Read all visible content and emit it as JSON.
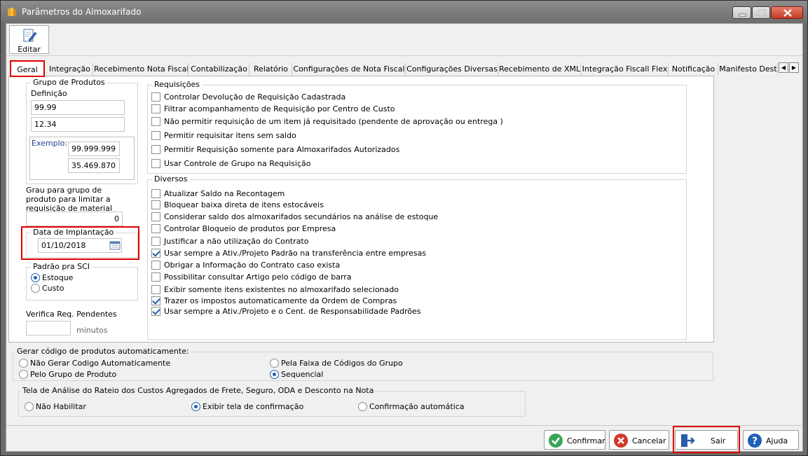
{
  "window": {
    "title": "Parâmetros do Almoxarifado"
  },
  "toolbar": {
    "edit_label": "Editar"
  },
  "tabs": [
    {
      "label": "Geral",
      "active": true
    },
    {
      "label": "Integração"
    },
    {
      "label": "Recebimento Nota Fiscal"
    },
    {
      "label": "Contabilização"
    },
    {
      "label": "Relatório"
    },
    {
      "label": "Configurações de Nota Fiscal"
    },
    {
      "label": "Configurações Diversas"
    },
    {
      "label": "Recebimento de XML"
    },
    {
      "label": "Integração Fiscall Flex"
    },
    {
      "label": "Notificação"
    },
    {
      "label": "Manifesto Dest"
    }
  ],
  "grupo_produtos": {
    "title": "Grupo de Produtos",
    "definicao_label": "Definição",
    "definicao_1": "99.99",
    "definicao_2": "12.34",
    "exemplo_label": "Exemplo:",
    "exemplo_1": "99.999.999",
    "exemplo_2": "35.469.870"
  },
  "grau": {
    "label": "Grau para grupo de produto para limitar a requisição de material",
    "value": "0"
  },
  "data_implantacao": {
    "title": "Data de Implantação",
    "value": "01/10/2018"
  },
  "padrao_sci": {
    "title": "Padrão pra SCI",
    "options": [
      {
        "label": "Estoque",
        "checked": true
      },
      {
        "label": "Custo",
        "checked": false
      }
    ]
  },
  "verifica": {
    "label": "Verifica Req. Pendentes",
    "value": "",
    "unit": "minutos"
  },
  "requisicoes": {
    "title": "Requisições",
    "items": [
      {
        "label": "Controlar Devolução de Requisição Cadastrada",
        "checked": false
      },
      {
        "label": "Filtrar acompanhamento de Requisição por Centro de Custo",
        "checked": false
      },
      {
        "label": "Não permitir requisição de um item já requisitado (pendente de aprovação ou entrega )",
        "checked": false
      },
      {
        "label": "Permitir requisitar itens sem saldo",
        "checked": false
      },
      {
        "label": "Permitir Requisição somente para Almoxarifados Autorizados",
        "checked": false
      },
      {
        "label": "Usar Controle de Grupo na Requisição",
        "checked": false
      }
    ]
  },
  "diversos": {
    "title": "Diversos",
    "items": [
      {
        "label": "Atualizar Saldo na Recontagem",
        "checked": false
      },
      {
        "label": "Bloquear baixa direta de itens estocáveis",
        "checked": false
      },
      {
        "label": "Considerar saldo dos almoxarifados secundários na análise de estoque",
        "checked": false
      },
      {
        "label": "Controlar Bloqueio de produtos por Empresa",
        "checked": false
      },
      {
        "label": "Justificar a não utilização do Contrato",
        "checked": false
      },
      {
        "label": "Usar sempre a Ativ./Projeto Padrão na transferência entre empresas",
        "checked": true
      },
      {
        "label": "Obrigar a Informação do Contrato caso exista",
        "checked": false
      },
      {
        "label": "Possibilitar consultar Artigo pelo código de barra",
        "checked": false
      },
      {
        "label": "Exibir somente itens existentes no almoxarifado selecionado",
        "checked": false
      },
      {
        "label": "Trazer os impostos automaticamente da Ordem de Compras",
        "checked": true
      },
      {
        "label": "Usar sempre a Ativ./Projeto e o Cent. de Responsabilidade Padrões",
        "checked": true
      }
    ]
  },
  "gerar_codigo": {
    "title": "Gerar código de produtos automaticamente:",
    "options": [
      {
        "label": "Não Gerar Codigo Automaticamente",
        "checked": false
      },
      {
        "label": "Pelo Grupo de Produto",
        "checked": false
      },
      {
        "label": "Pela Faixa de Códigos do Grupo",
        "checked": false
      },
      {
        "label": "Sequencial",
        "checked": true
      }
    ]
  },
  "rateio": {
    "title": "Tela de Análise do Rateio dos Custos Agregados de Frete, Seguro, ODA e Desconto na Nota",
    "options": [
      {
        "label": "Não Habilitar",
        "checked": false
      },
      {
        "label": "Exibir tela de confirmação",
        "checked": true
      },
      {
        "label": "Confirmação automática",
        "checked": false
      }
    ]
  },
  "buttons": {
    "confirmar": "Confirmar",
    "cancelar": "Cancelar",
    "sair": "Sair",
    "ajuda": "Ajuda"
  },
  "colors": {
    "highlight": "#e00000",
    "accent": "#1e5fb4"
  }
}
